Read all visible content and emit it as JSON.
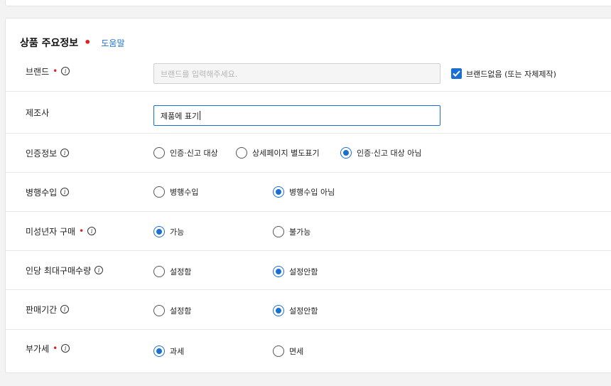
{
  "section": {
    "title": "상품 주요정보",
    "help": "도움말"
  },
  "brand": {
    "label": "브랜드",
    "placeholder": "브랜드를 입력해주세요.",
    "no_brand_label": "브랜드없음 (또는 자체제작)",
    "no_brand_checked": true
  },
  "manufacturer": {
    "label": "제조사",
    "value": "제품에 표기"
  },
  "certification": {
    "label": "인증정보",
    "options": [
      "인증·신고 대상",
      "상세페이지 별도표기",
      "인증·신고 대상 아님"
    ],
    "selected": 2
  },
  "parallel_import": {
    "label": "병행수입",
    "options": [
      "병행수입",
      "병행수입 아님"
    ],
    "selected": 1
  },
  "minor_purchase": {
    "label": "미성년자 구매",
    "options": [
      "가능",
      "불가능"
    ],
    "selected": 0
  },
  "max_purchase": {
    "label": "인당 최대구매수량",
    "options": [
      "설정함",
      "설정안함"
    ],
    "selected": 1
  },
  "sale_period": {
    "label": "판매기간",
    "options": [
      "설정함",
      "설정안함"
    ],
    "selected": 1
  },
  "vat": {
    "label": "부가세",
    "options": [
      "과세",
      "면세"
    ],
    "selected": 0
  },
  "colors": {
    "accent": "#1a6fd3",
    "required": "#e02020"
  }
}
